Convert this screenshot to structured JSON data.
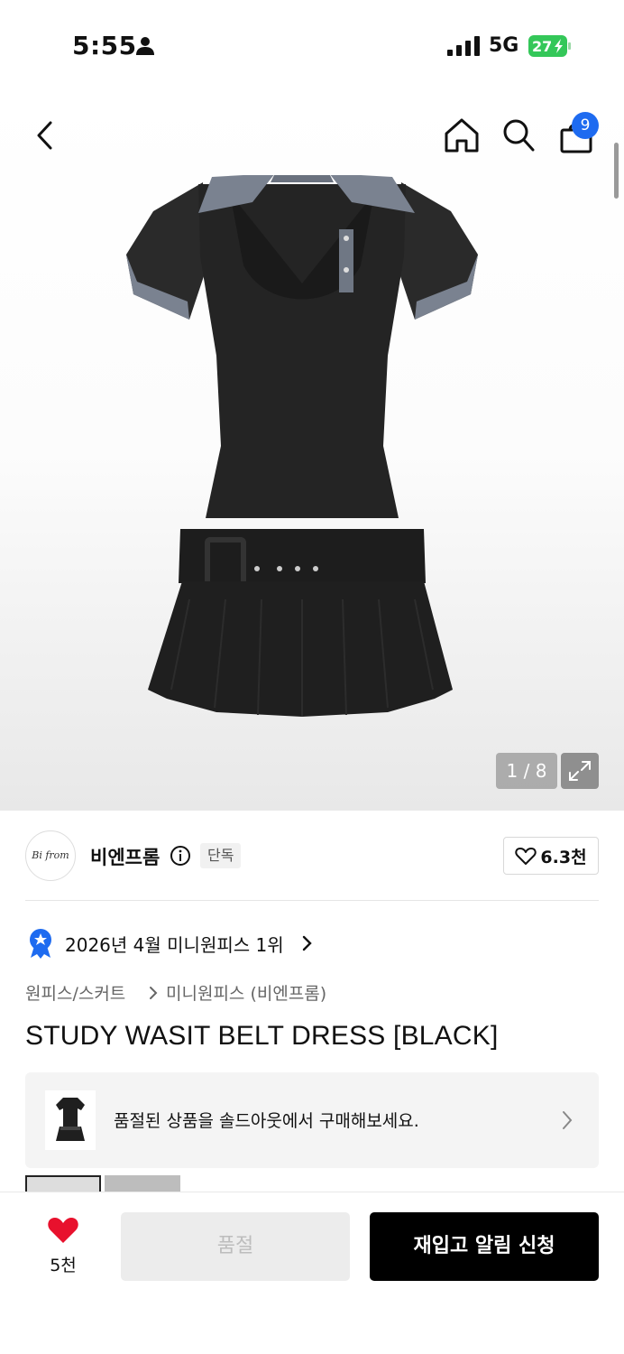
{
  "status_bar": {
    "time": "5:55",
    "network": "5G",
    "battery": "27"
  },
  "nav": {
    "cart_count": "9"
  },
  "gallery": {
    "counter": "1 / 8"
  },
  "brand": {
    "logo_text": "Bi from",
    "name": "비엔프롬",
    "exclusive_badge": "단독",
    "like_count": "6.3천"
  },
  "ranking": {
    "text": "2026년 4월 미니원피스 1위"
  },
  "breadcrumb": {
    "category": "원피스/스커트",
    "subcategory": "미니원피스 (비엔프롬)"
  },
  "product": {
    "title": "STUDY WASIT BELT DRESS [BLACK]"
  },
  "soldout_banner": {
    "text": "품절된 상품을 솔드아웃에서 구매해보세요."
  },
  "bottom_bar": {
    "wish_count": "5천",
    "soldout_label": "품절",
    "restock_label": "재입고 알림 신청"
  },
  "colors": {
    "accent_blue": "#1e6bf0",
    "heart_red": "#e8112d",
    "battery_green": "#34c759"
  }
}
